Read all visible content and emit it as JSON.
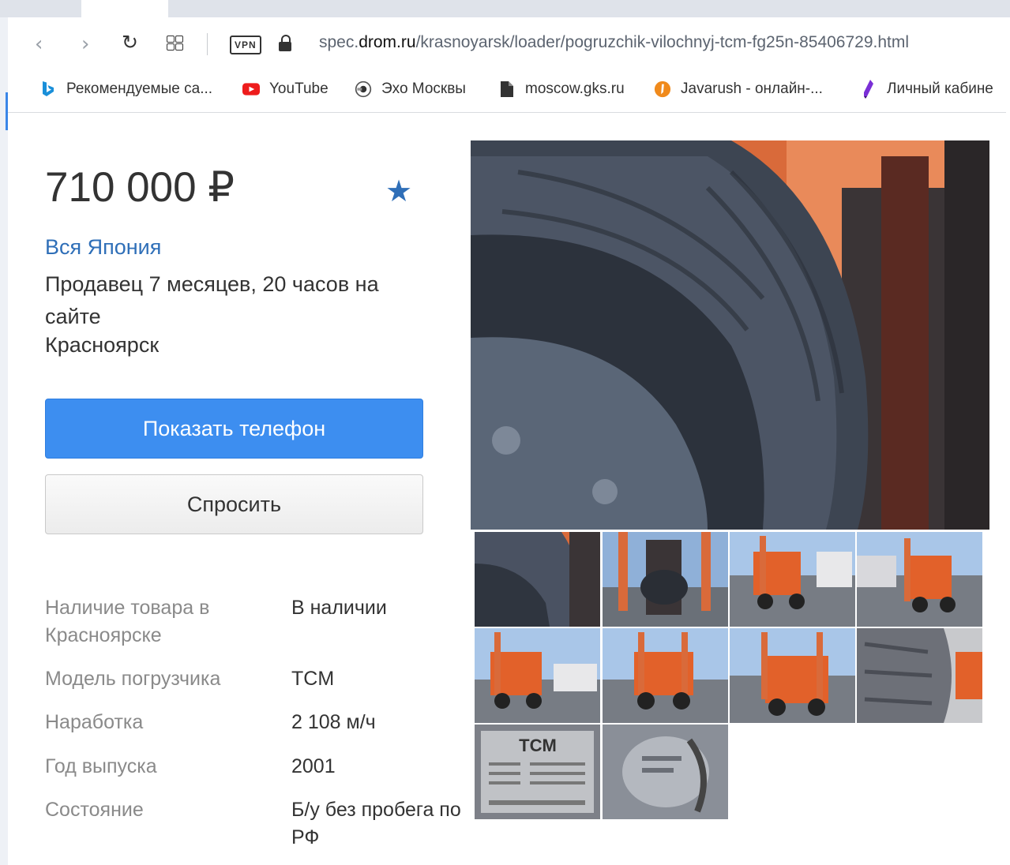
{
  "browser": {
    "url_prefix": "spec.",
    "url_domain": "drom.ru",
    "url_path": "/krasnoyarsk/loader/pogruzchik-vilochnyj-tcm-fg25n-85406729.html",
    "vpn_label": "VPN",
    "back_icon": "chevron-left-icon",
    "forward_icon": "chevron-right-icon",
    "reload_icon": "reload-icon",
    "apps_icon": "grid-icon",
    "lock_icon": "lock-icon"
  },
  "bookmarks": [
    {
      "label": "Рекомендуемые са...",
      "icon": "bing-icon"
    },
    {
      "label": "YouTube",
      "icon": "youtube-icon"
    },
    {
      "label": "Эхо Москвы",
      "icon": "echo-icon"
    },
    {
      "label": "moscow.gks.ru",
      "icon": "document-icon"
    },
    {
      "label": "Javarush - онлайн-...",
      "icon": "javarush-icon"
    },
    {
      "label": "Личный кабине",
      "icon": "cabinet-icon"
    }
  ],
  "listing": {
    "price": "710 000 ₽",
    "favorite_icon": "star-icon",
    "seller_name": "Вся Япония",
    "seller_since": "Продавец 7 месяцев, 20 часов на сайте",
    "city": "Красноярск",
    "show_phone_label": "Показать телефон",
    "ask_label": "Спросить"
  },
  "specs": [
    {
      "label": "Наличие товара в Красноярске",
      "value": "В наличии"
    },
    {
      "label": "Модель погрузчика",
      "value": "TCM"
    },
    {
      "label": "Наработка",
      "value": "2 108 м/ч"
    },
    {
      "label": "Год выпуска",
      "value": "2001"
    },
    {
      "label": "Состояние",
      "value": "Б/у без пробега по РФ"
    }
  ],
  "gallery": {
    "thumbnail_count": 10,
    "nameplate_text": "TCM"
  },
  "colors": {
    "accent_blue": "#3d8ef0",
    "link_blue": "#2f6fb8",
    "forklift_orange": "#e2612a"
  }
}
